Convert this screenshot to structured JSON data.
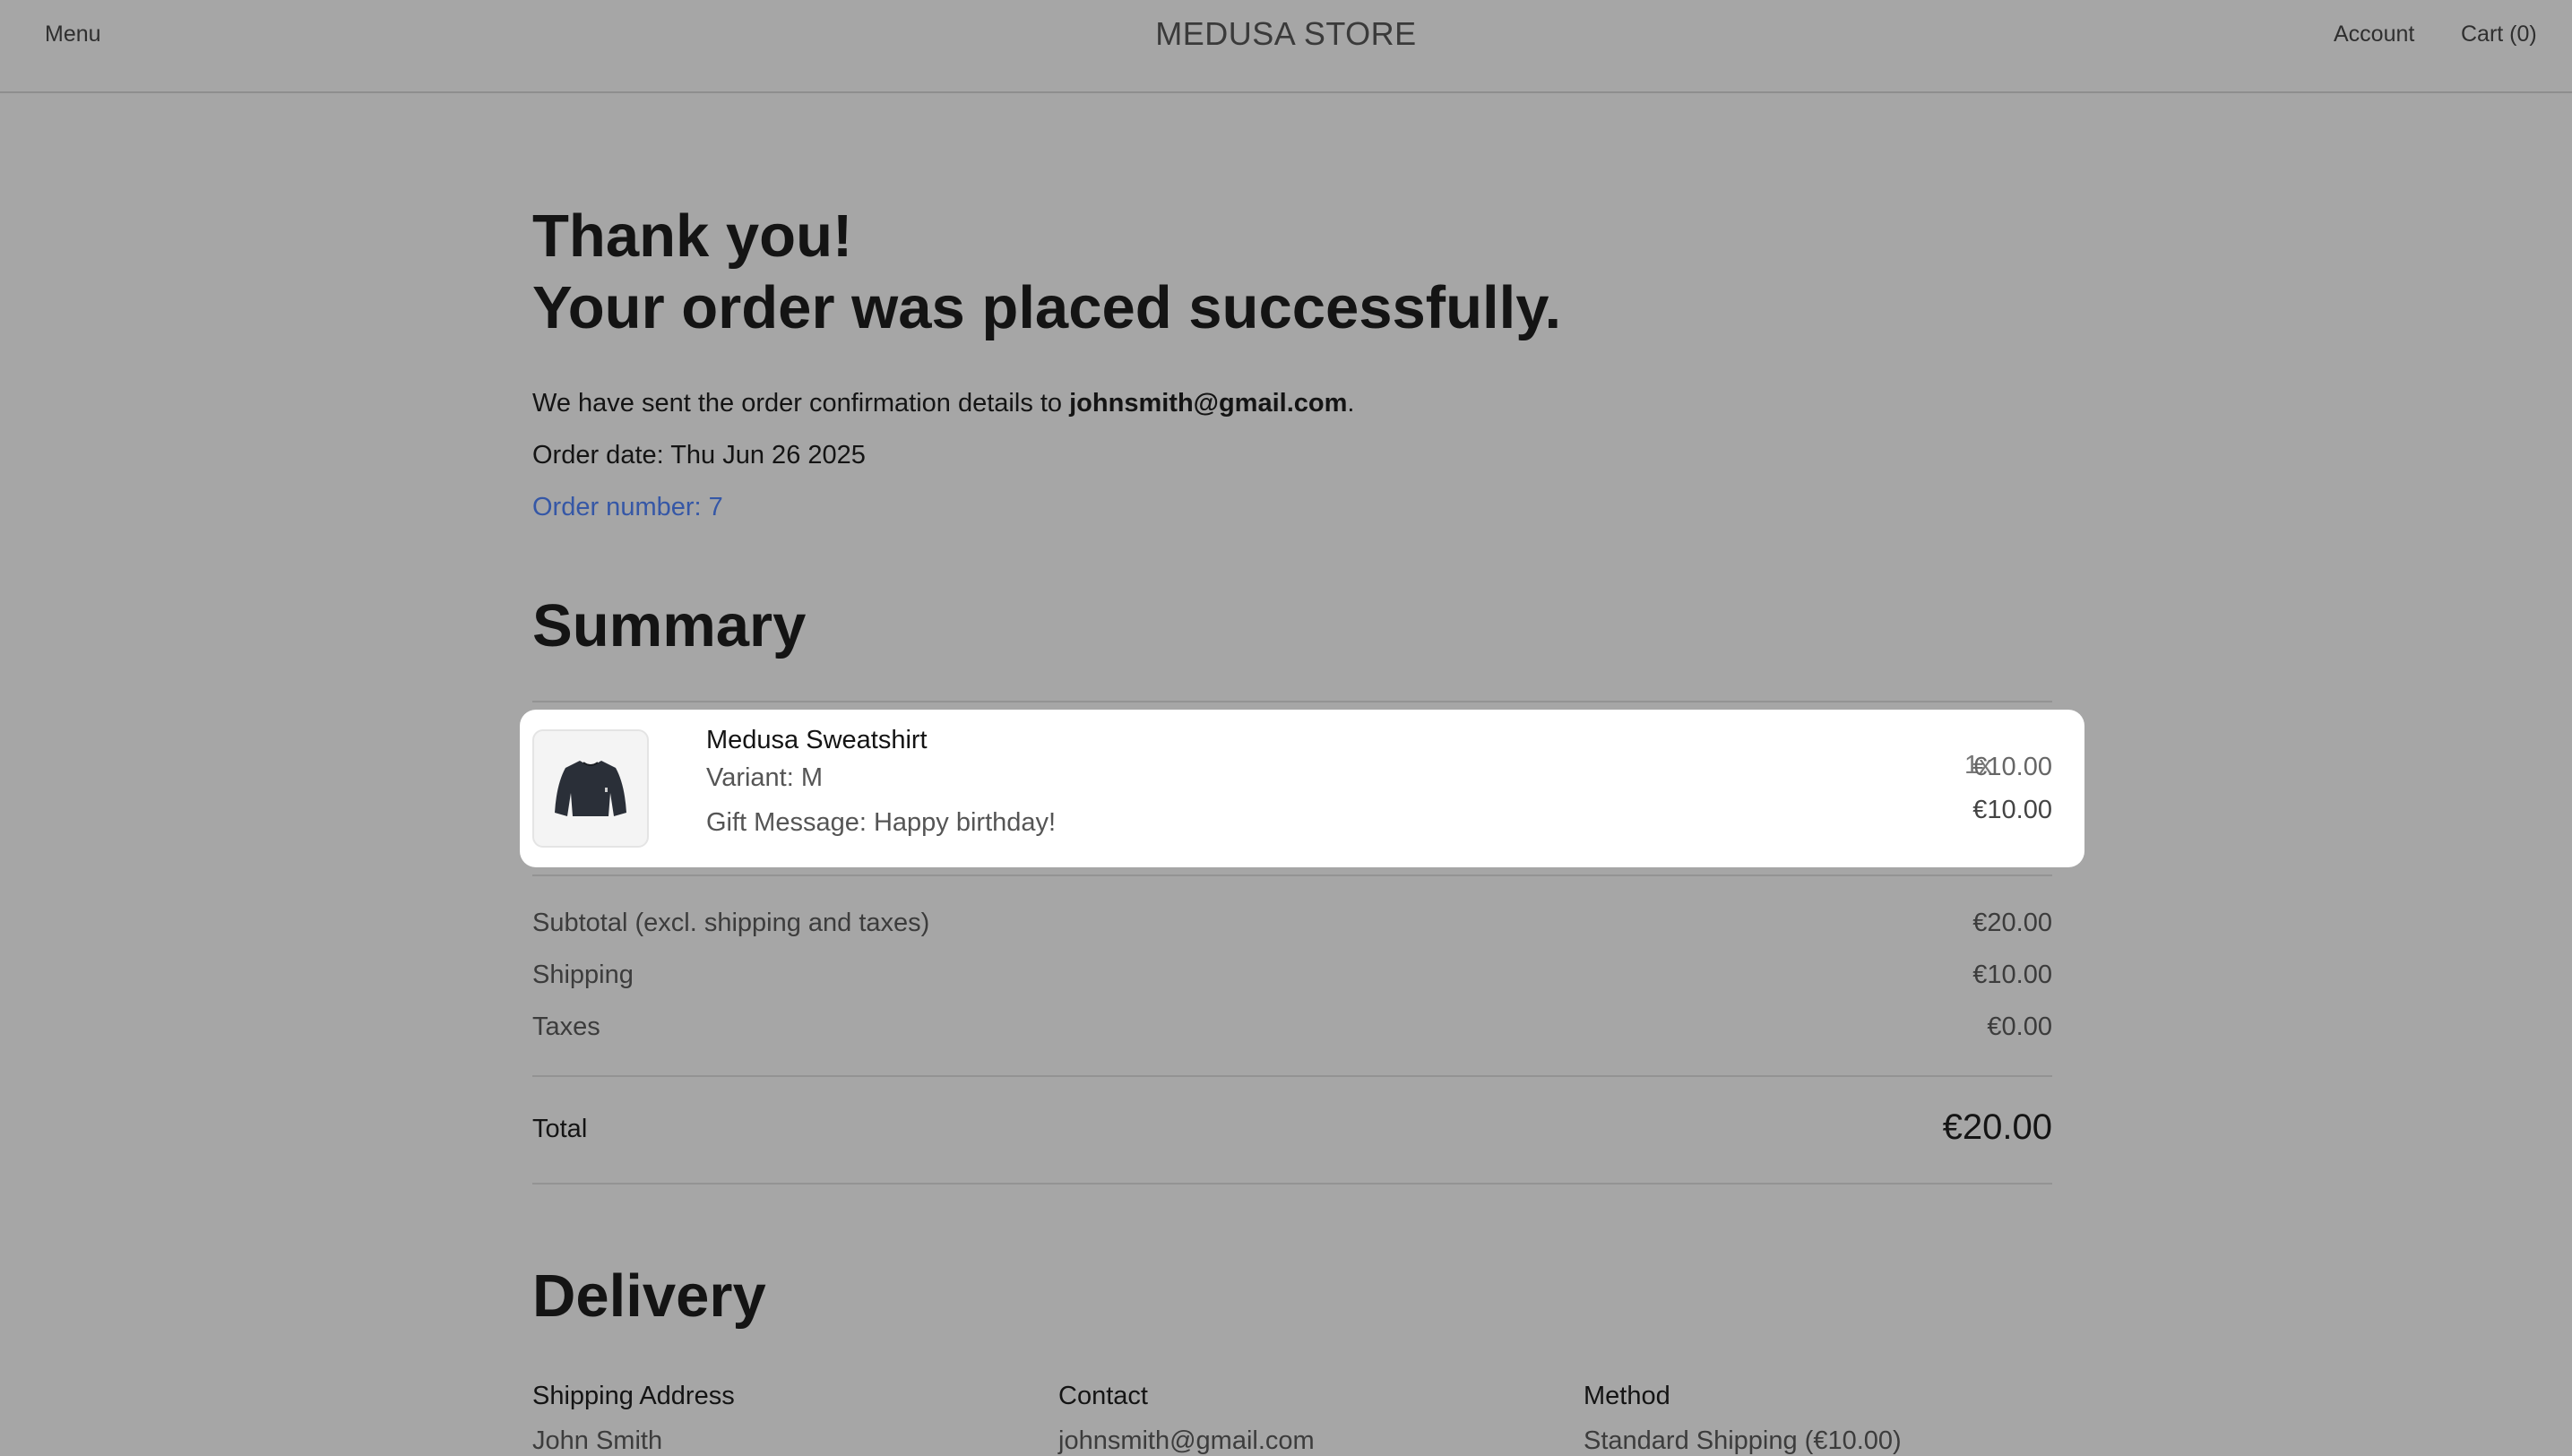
{
  "header": {
    "menu_label": "Menu",
    "store_name": "MEDUSA STORE",
    "account_label": "Account",
    "cart_label": "Cart (0)"
  },
  "confirmation": {
    "thanks_line1": "Thank you!",
    "thanks_line2": "Your order was placed successfully.",
    "sent_prefix": "We have sent the order confirmation details to ",
    "email": "johnsmith@gmail.com",
    "sent_suffix": ".",
    "order_date": "Order date: Thu Jun 26 2025",
    "order_number": "Order number: 7"
  },
  "summary": {
    "heading": "Summary",
    "item": {
      "icon": "sweatshirt-image",
      "name": "Medusa Sweatshirt",
      "variant": "Variant: M",
      "gift_message": "Gift Message: Happy birthday!",
      "quantity": "1x",
      "unit_price": "€10.00",
      "line_total": "€10.00"
    },
    "subtotal_label": "Subtotal (excl. shipping and taxes)",
    "subtotal_value": "€20.00",
    "shipping_label": "Shipping",
    "shipping_value": "€10.00",
    "taxes_label": "Taxes",
    "taxes_value": "€0.00",
    "total_label": "Total",
    "total_value": "€20.00"
  },
  "delivery": {
    "heading": "Delivery",
    "shipping_address_label": "Shipping Address",
    "shipping_address_name": "John Smith",
    "contact_label": "Contact",
    "contact_email": "johnsmith@gmail.com",
    "method_label": "Method",
    "method_value": "Standard Shipping (€10.00)"
  },
  "colors": {
    "page_background": "#a6a6a6",
    "card_background": "#ffffff",
    "link_blue": "#3557a6"
  }
}
